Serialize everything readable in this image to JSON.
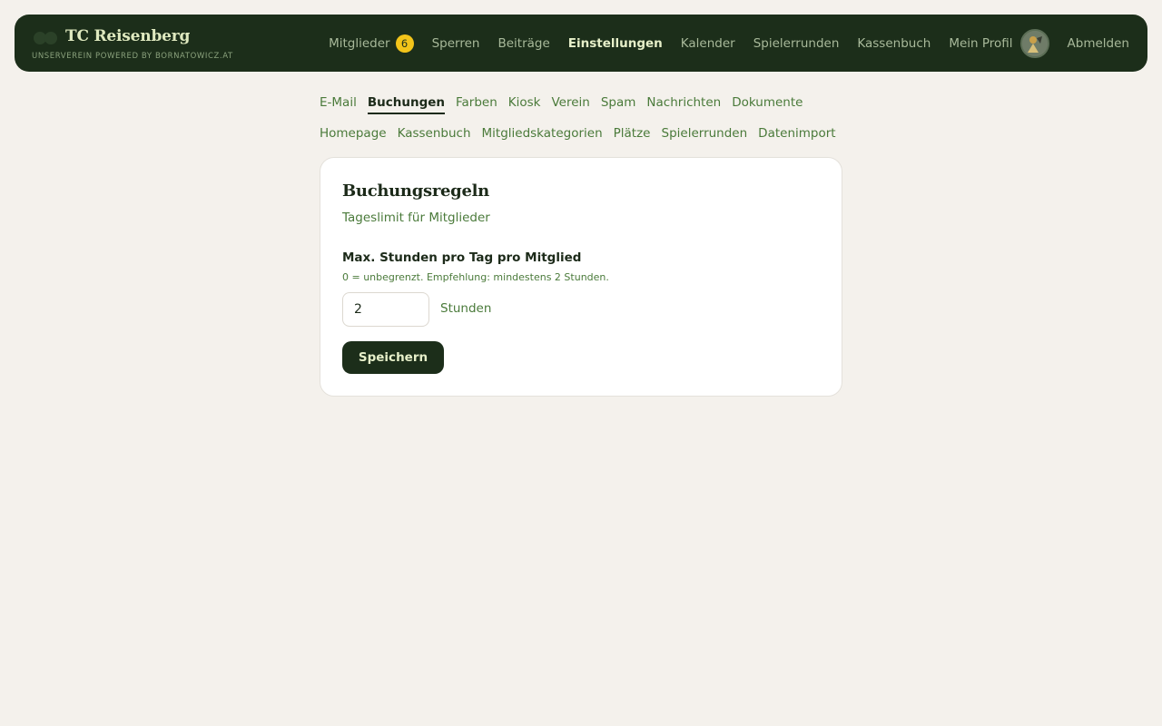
{
  "brand": {
    "title": "TC Reisenberg",
    "subtitle": "UNSERVEREIN POWERED BY BORNATOWICZ.AT"
  },
  "nav": {
    "members": "Mitglieder",
    "members_badge": "6",
    "locks": "Sperren",
    "fees": "Beiträge",
    "settings": "Einstellungen",
    "calendar": "Kalender",
    "rounds": "Spielerrunden",
    "cashbook": "Kassenbuch",
    "profile": "Mein Profil",
    "logout": "Abmelden"
  },
  "subnav": {
    "row1": [
      "E-Mail",
      "Buchungen",
      "Farben",
      "Kiosk",
      "Verein",
      "Spam",
      "Nachrichten",
      "Dokumente"
    ],
    "row2": [
      "Homepage",
      "Kassenbuch",
      "Mitgliedskategorien",
      "Plätze",
      "Spielerrunden",
      "Datenimport"
    ],
    "active": "Buchungen"
  },
  "card": {
    "title": "Buchungsregeln",
    "subtitle": "Tageslimit für Mitglieder",
    "field_label": "Max. Stunden pro Tag pro Mitglied",
    "field_hint": "0 = unbegrenzt. Empfehlung: mindestens 2 Stunden.",
    "field_value": "2",
    "unit": "Stunden",
    "save_label": "Speichern"
  },
  "colors": {
    "topbar": "#1c2e1a",
    "background": "#f4f1ec",
    "accent_green": "#4a7a3a",
    "badge": "#f2c41a"
  }
}
